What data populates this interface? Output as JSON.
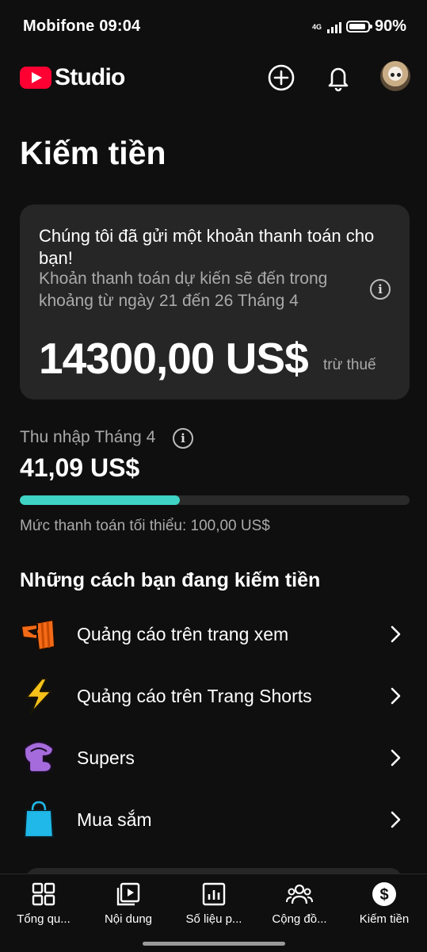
{
  "status_bar": {
    "carrier_time": "Mobifone 09:04",
    "network": "4G",
    "battery": "90%"
  },
  "header": {
    "logo_text": "Studio"
  },
  "page": {
    "title": "Kiếm tiền"
  },
  "payment_card": {
    "title": "Chúng tôi đã gửi một khoản thanh toán cho bạn!",
    "subtitle": "Khoản thanh toán dự kiến sẽ đến trong khoảng từ ngày 21 đến 26 Tháng 4",
    "amount": "14300,00 US$",
    "tax_note": "trừ thuế"
  },
  "income": {
    "label": "Thu nhập Tháng 4",
    "amount": "41,09 US$",
    "progress_fraction": 0.411,
    "min_payment": "Mức thanh toán tối thiểu: 100,00 US$",
    "progress_color": "#3ed3c4"
  },
  "ways": {
    "title": "Những cách bạn đang kiếm tiền",
    "items": [
      {
        "label": "Quảng cáo trên trang xem",
        "icon": "popcorn-icon"
      },
      {
        "label": "Quảng cáo trên Trang Shorts",
        "icon": "lightning-icon"
      },
      {
        "label": "Supers",
        "icon": "supers-icon"
      },
      {
        "label": "Mua sắm",
        "icon": "shopping-bag-icon"
      }
    ]
  },
  "bottom_nav": {
    "items": [
      {
        "label": "Tổng qu...",
        "icon": "dashboard-icon"
      },
      {
        "label": "Nội dung",
        "icon": "content-icon"
      },
      {
        "label": "Số liệu p...",
        "icon": "analytics-icon"
      },
      {
        "label": "Cộng đồ...",
        "icon": "community-icon"
      },
      {
        "label": "Kiếm tiền",
        "icon": "earn-icon",
        "active": true
      }
    ]
  },
  "colors": {
    "brand_red": "#ff0033",
    "background": "#0f0f0f",
    "card": "#262626"
  }
}
